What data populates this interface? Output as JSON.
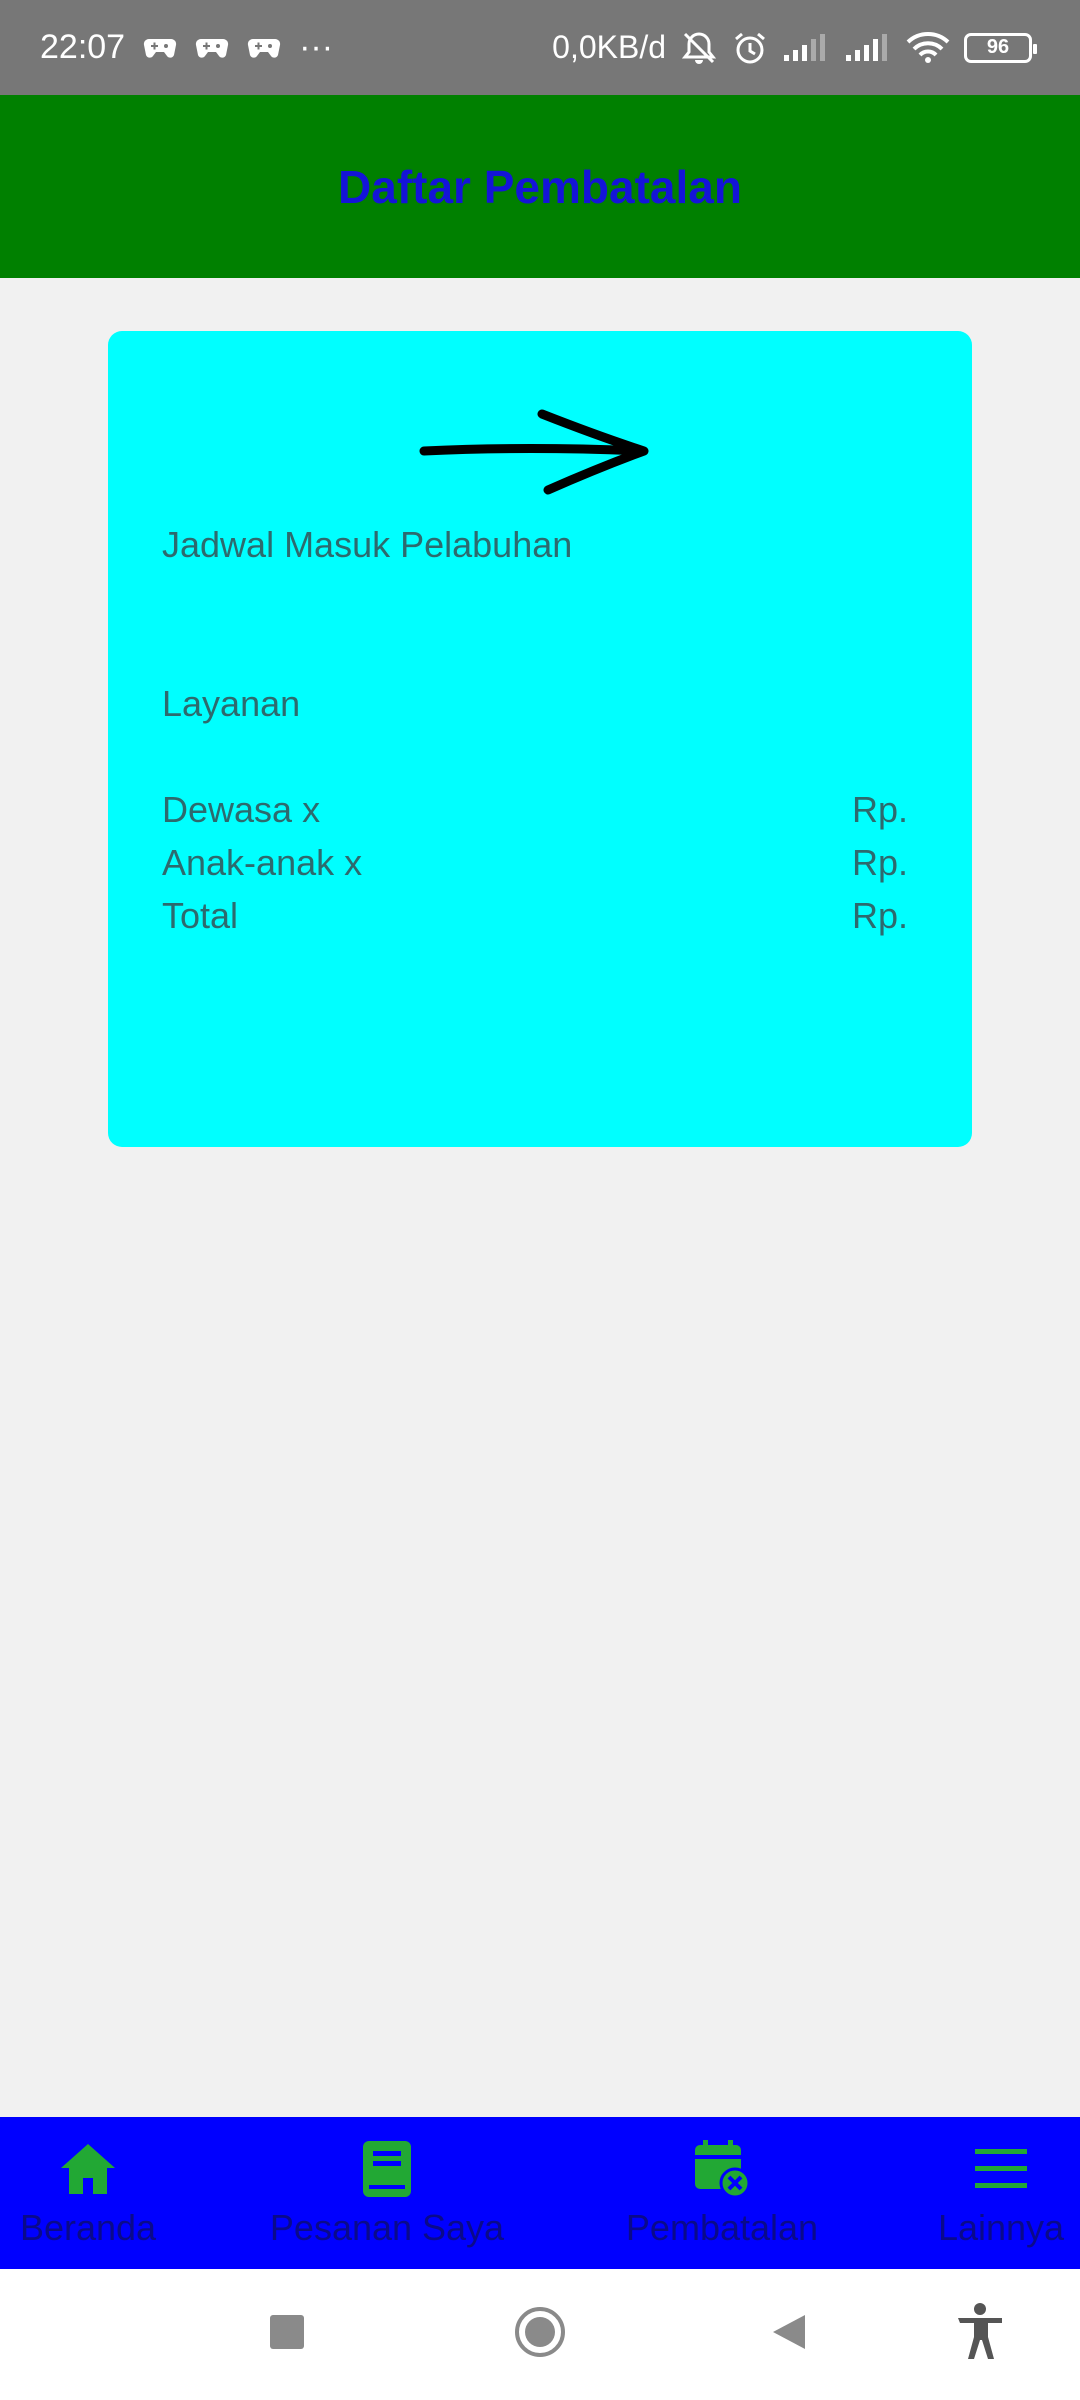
{
  "status_bar": {
    "time": "22:07",
    "more": "···",
    "net_speed": "0,0KB/d",
    "battery": "96"
  },
  "app_bar": {
    "title": "Daftar Pembatalan"
  },
  "card": {
    "arrow_icon": "right-arrow",
    "schedule_label": "Jadwal Masuk Pelabuhan",
    "service_label": "Layanan",
    "rows": [
      {
        "label": "Dewasa x",
        "value": "Rp."
      },
      {
        "label": "Anak-anak x",
        "value": "Rp."
      },
      {
        "label": "Total",
        "value": "Rp."
      }
    ],
    "background": "#00ffff"
  },
  "bottom_nav": {
    "items": [
      {
        "label": "Beranda",
        "icon": "home-icon"
      },
      {
        "label": "Pesanan Saya",
        "icon": "book-icon"
      },
      {
        "label": "Pembatalan",
        "icon": "calendar-cancel-icon"
      },
      {
        "label": "Lainnya",
        "icon": "menu-icon"
      }
    ],
    "background": "#0000ff",
    "icon_color": "#22a834"
  },
  "colors": {
    "app_bar": "#008000",
    "title": "#1414d8",
    "status_bar": "#777777"
  }
}
